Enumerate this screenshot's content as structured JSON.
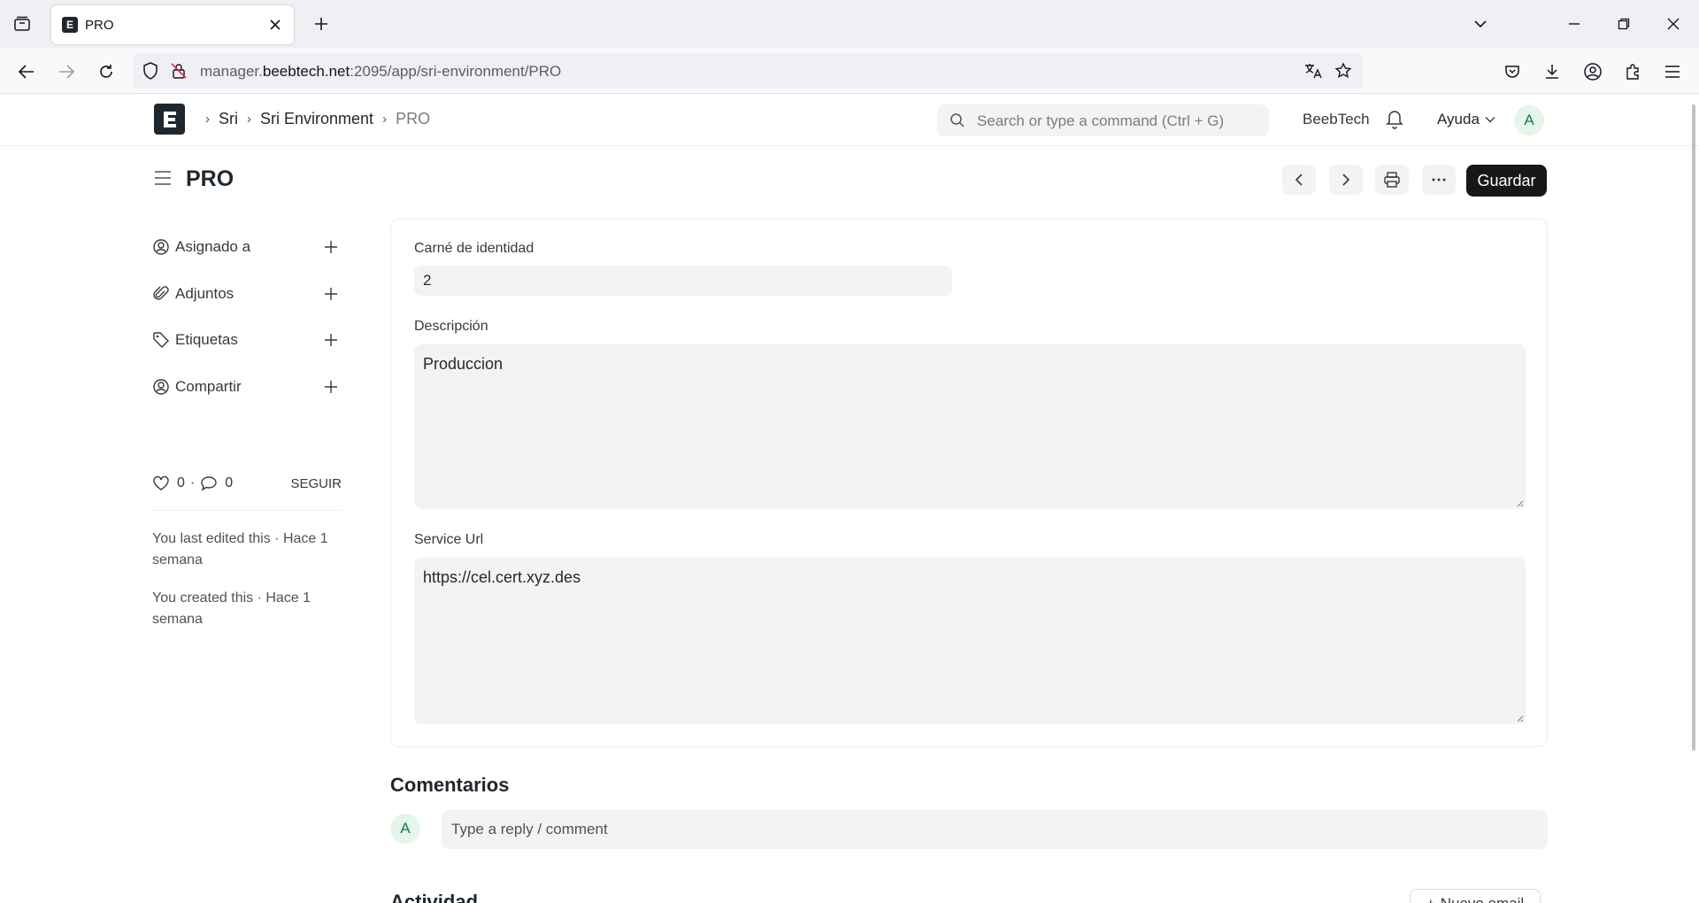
{
  "browser": {
    "tab_title": "PRO",
    "tab_favicon_letter": "E",
    "url_prefix": "manager.",
    "url_host": "beebtech.net",
    "url_rest": ":2095/app/sri-environment/PRO"
  },
  "app": {
    "breadcrumbs": [
      "Sri",
      "Sri Environment",
      "PRO"
    ],
    "search_placeholder": "Search or type a command (Ctrl + G)",
    "org_name": "BeebTech",
    "help_label": "Ayuda",
    "avatar_letter": "A"
  },
  "page": {
    "title": "PRO",
    "save_label": "Guardar"
  },
  "sidebar": {
    "items": [
      {
        "label": "Asignado a",
        "icon": "assign-user-icon"
      },
      {
        "label": "Adjuntos",
        "icon": "paperclip-icon"
      },
      {
        "label": "Etiquetas",
        "icon": "tag-icon"
      },
      {
        "label": "Compartir",
        "icon": "share-user-icon"
      }
    ],
    "likes": "0",
    "comments": "0",
    "dot": "·",
    "follow_label": "SEGUIR",
    "last_edited": "You last edited this · Hace 1 semana",
    "created": "You created this · Hace 1 semana"
  },
  "form": {
    "fields": [
      {
        "label": "Carné de identidad",
        "value": "2"
      },
      {
        "label": "Descripción",
        "value": "Produccion"
      },
      {
        "label": "Service Url",
        "value": "https://cel.cert.xyz.des"
      }
    ]
  },
  "comments": {
    "title": "Comentarios",
    "placeholder": "Type a reply / comment",
    "avatar_letter": "A"
  },
  "activity": {
    "title": "Actividad",
    "new_email_label": "Nuevo email",
    "new_email_icon": "+"
  }
}
